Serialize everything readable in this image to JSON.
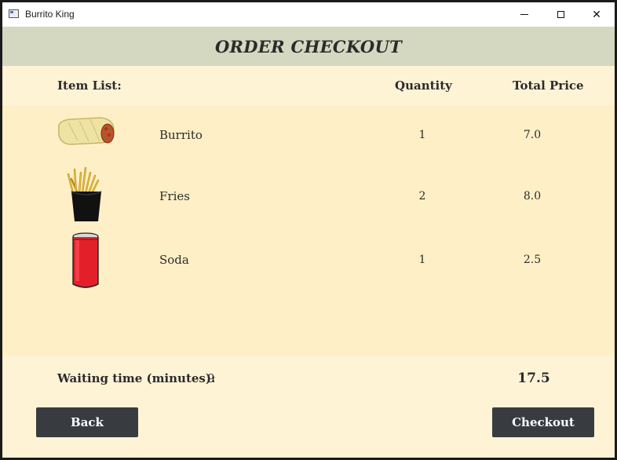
{
  "window": {
    "title": "Burrito King",
    "controls": {
      "minimize": "minimize",
      "maximize": "maximize",
      "close": "✕"
    }
  },
  "header": {
    "title": "ORDER CHECKOUT"
  },
  "columns": {
    "items": "Item List:",
    "quantity": "Quantity",
    "total_price": "Total Price"
  },
  "items": [
    {
      "icon": "burrito-icon",
      "name": "Burrito",
      "quantity": "1",
      "price": "7.0"
    },
    {
      "icon": "fries-icon",
      "name": "Fries",
      "quantity": "2",
      "price": "8.0"
    },
    {
      "icon": "soda-icon",
      "name": "Soda",
      "quantity": "1",
      "price": "2.5"
    }
  ],
  "footer": {
    "waiting_label": "Waiting time (minutes):",
    "waiting_value": "9",
    "total": "17.5"
  },
  "buttons": {
    "back": "Back",
    "checkout": "Checkout"
  },
  "colors": {
    "header_bg": "#d4d8c0",
    "list_bg": "#ffefc6",
    "page_bg": "#fff3d6",
    "button_bg": "#383c40"
  }
}
